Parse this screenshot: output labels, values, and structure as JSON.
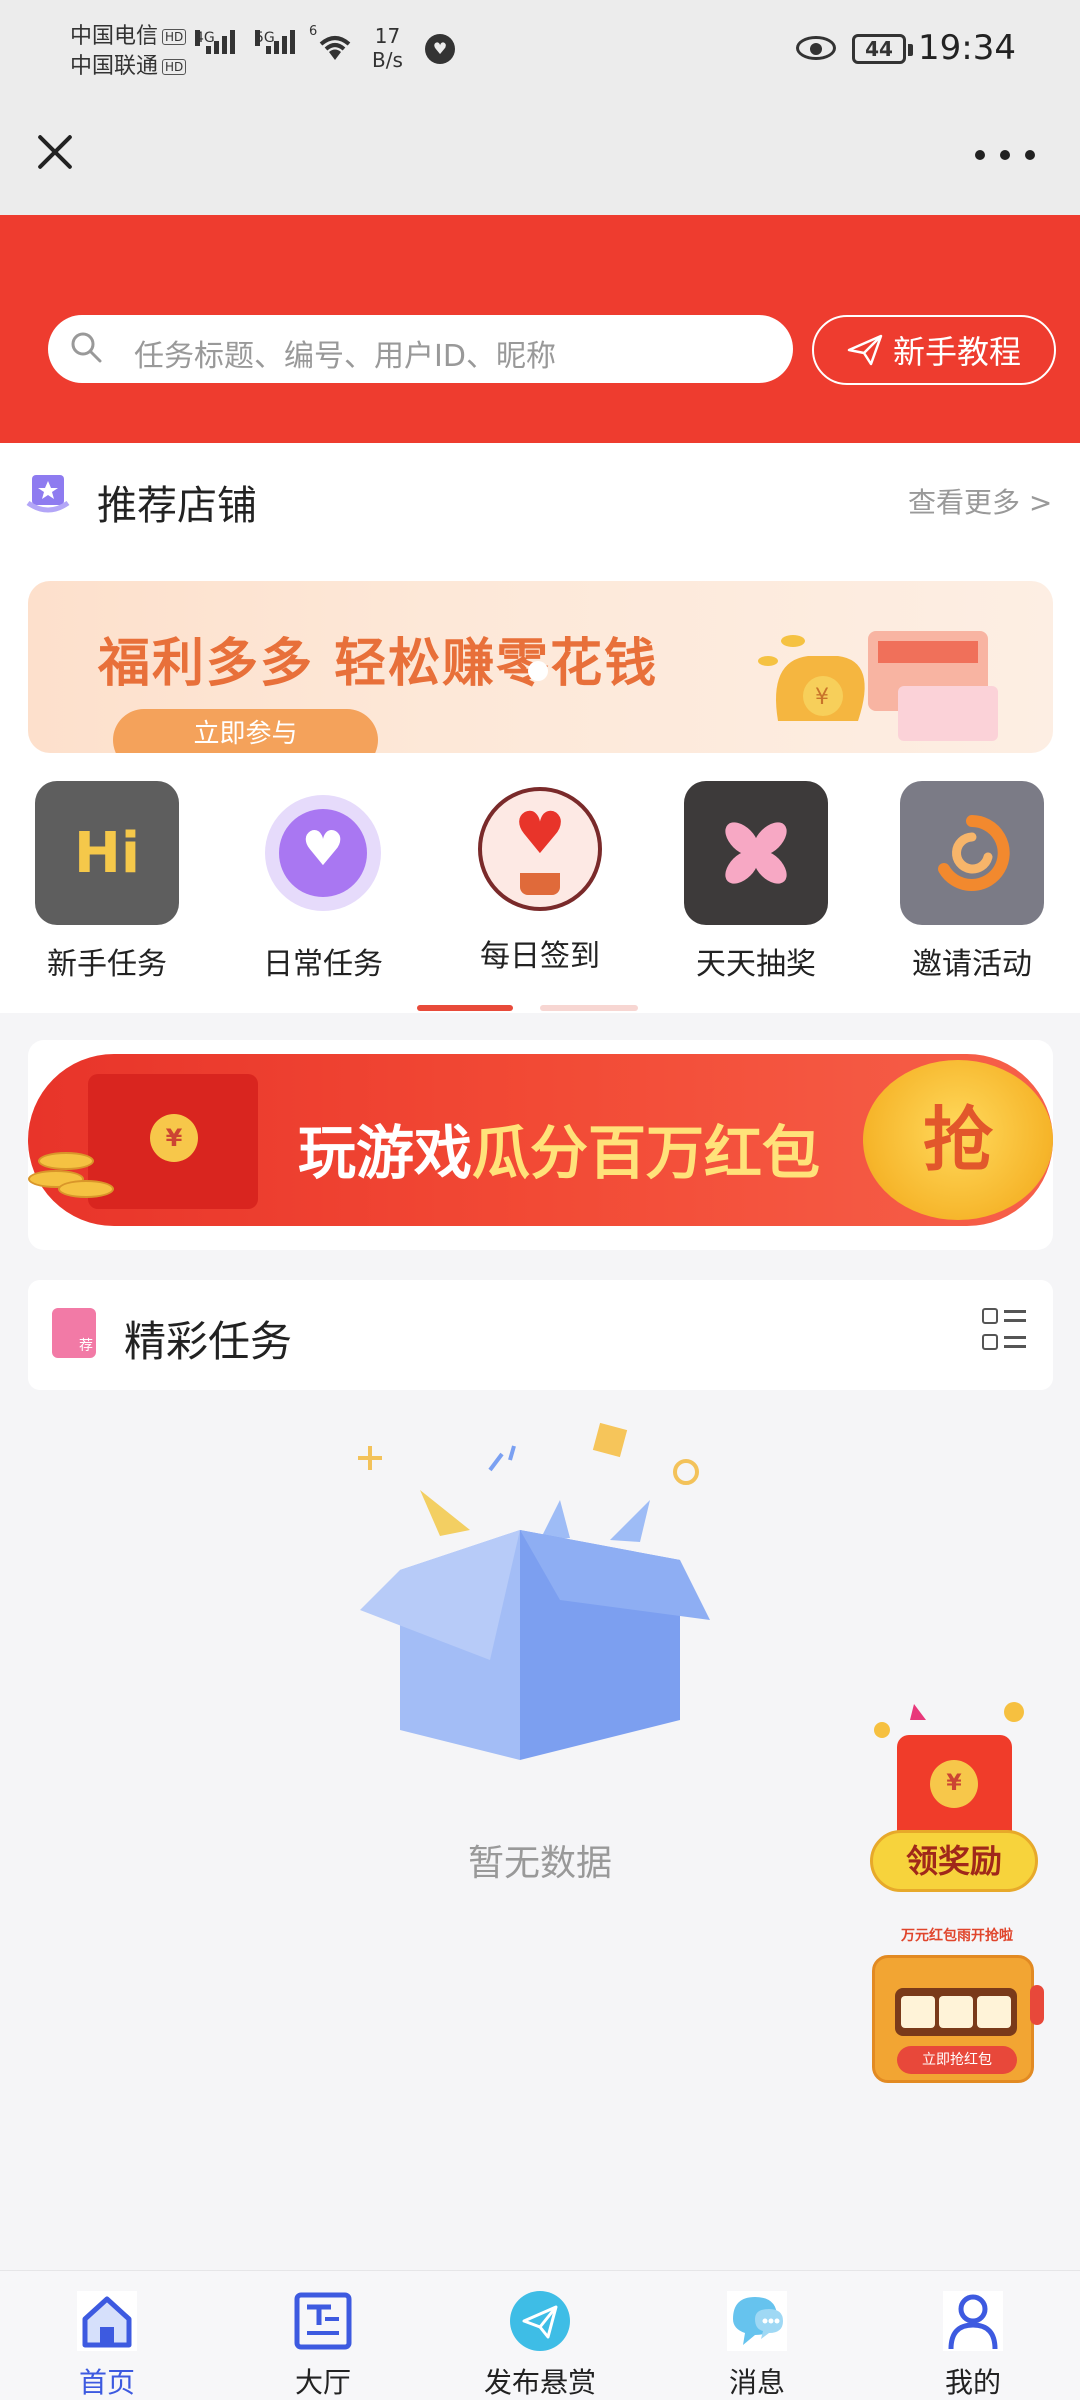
{
  "status_bar": {
    "carrier1": "中国电信",
    "carrier2": "中国联通",
    "hd_badge": "HD",
    "net1": "4G",
    "net2": "5G",
    "wifi_level": "6",
    "speed_value": "17",
    "speed_unit": "B/s",
    "battery": "44",
    "time": "19:34"
  },
  "topbar": {
    "close_icon": "close-icon",
    "more_icon": "more-icon"
  },
  "search": {
    "placeholder": "任务标题、编号、用户ID、昵称",
    "tutorial_label": "新手教程",
    "colors": {
      "header_bg": "#ee3c2f"
    }
  },
  "store": {
    "title": "推荐店铺",
    "see_more": "查看更多 >",
    "banner_text": "福利多多 轻松赚零花钱",
    "banner_button": "立即参与"
  },
  "quick_icons": [
    {
      "label": "新手任务",
      "icon": "hi-icon",
      "glyph": "Hi"
    },
    {
      "label": "日常任务",
      "icon": "heart-icon",
      "glyph": "♥"
    },
    {
      "label": "每日签到",
      "icon": "heart-plant-icon",
      "glyph": "♥"
    },
    {
      "label": "天天抽奖",
      "icon": "pinwheel-icon",
      "glyph": "✕"
    },
    {
      "label": "邀请活动",
      "icon": "swirl-icon",
      "glyph": "◔"
    }
  ],
  "promo": {
    "text_white": "玩游戏",
    "text_yellow": "瓜分百万红包",
    "grab_label": "抢",
    "coin_symbol": "¥"
  },
  "featured": {
    "title": "精彩任务",
    "empty_text": "暂无数据"
  },
  "floating": {
    "reward_label": "领奖励",
    "reward_coin": "¥",
    "slot_header": "万元红包雨开抢啦",
    "slot_button": "立即抢红包"
  },
  "bottom_nav": [
    {
      "label": "首页",
      "icon": "home-icon",
      "active": true
    },
    {
      "label": "大厅",
      "icon": "hall-icon",
      "active": false
    },
    {
      "label": "发布悬赏",
      "icon": "publish-icon",
      "active": false
    },
    {
      "label": "消息",
      "icon": "message-icon",
      "active": false
    },
    {
      "label": "我的",
      "icon": "profile-icon",
      "active": false
    }
  ]
}
